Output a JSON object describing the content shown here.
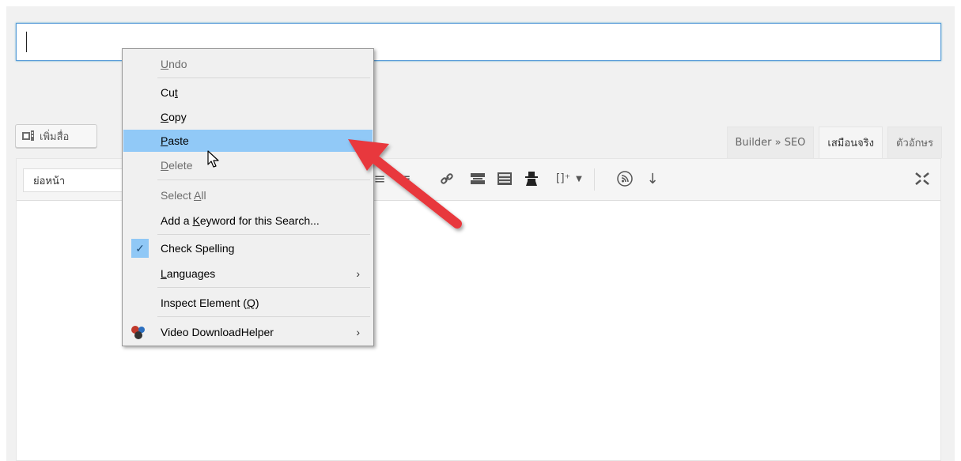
{
  "editor": {
    "title_value": "",
    "add_media_label": "เพิ่มสื่อ",
    "tabs": [
      "Builder » SEO",
      "เสมือนจริง",
      "ตัวอักษร"
    ],
    "format_select": "ย่อหน้า"
  },
  "context_menu": {
    "items": [
      {
        "pre": "",
        "u": "U",
        "post": "ndo",
        "state": "disabled"
      },
      {
        "pre": "Cu",
        "u": "t",
        "post": "",
        "state": "normal"
      },
      {
        "pre": "",
        "u": "C",
        "post": "opy",
        "state": "normal"
      },
      {
        "pre": "",
        "u": "P",
        "post": "aste",
        "state": "highlighted"
      },
      {
        "pre": "",
        "u": "D",
        "post": "elete",
        "state": "disabled"
      },
      {
        "pre": "Select ",
        "u": "A",
        "post": "ll",
        "state": "disabled"
      },
      {
        "pre": "Add a ",
        "u": "K",
        "post": "eyword for this Search...",
        "state": "normal"
      },
      {
        "pre": "Check Spellin",
        "u": "g",
        "post": "",
        "state": "checked"
      },
      {
        "pre": "",
        "u": "L",
        "post": "anguages",
        "state": "submenu"
      },
      {
        "pre": "Inspect Element (",
        "u": "Q",
        "post": ")",
        "state": "normal"
      },
      {
        "pre": "Video DownloadHelper",
        "u": "",
        "post": "",
        "state": "submenu"
      }
    ]
  },
  "colors": {
    "highlight": "#91c9f7",
    "focus_border": "#5b9dd9",
    "annotation_arrow": "#e8383d"
  },
  "icons": {
    "check": "checkmark-icon",
    "submenu": "chevron-right-icon",
    "addon": "video-downloadhelper-icon",
    "media": "add-media-icon",
    "pointer": "mouse-cursor-icon",
    "annotation": "red-arrow-icon"
  }
}
